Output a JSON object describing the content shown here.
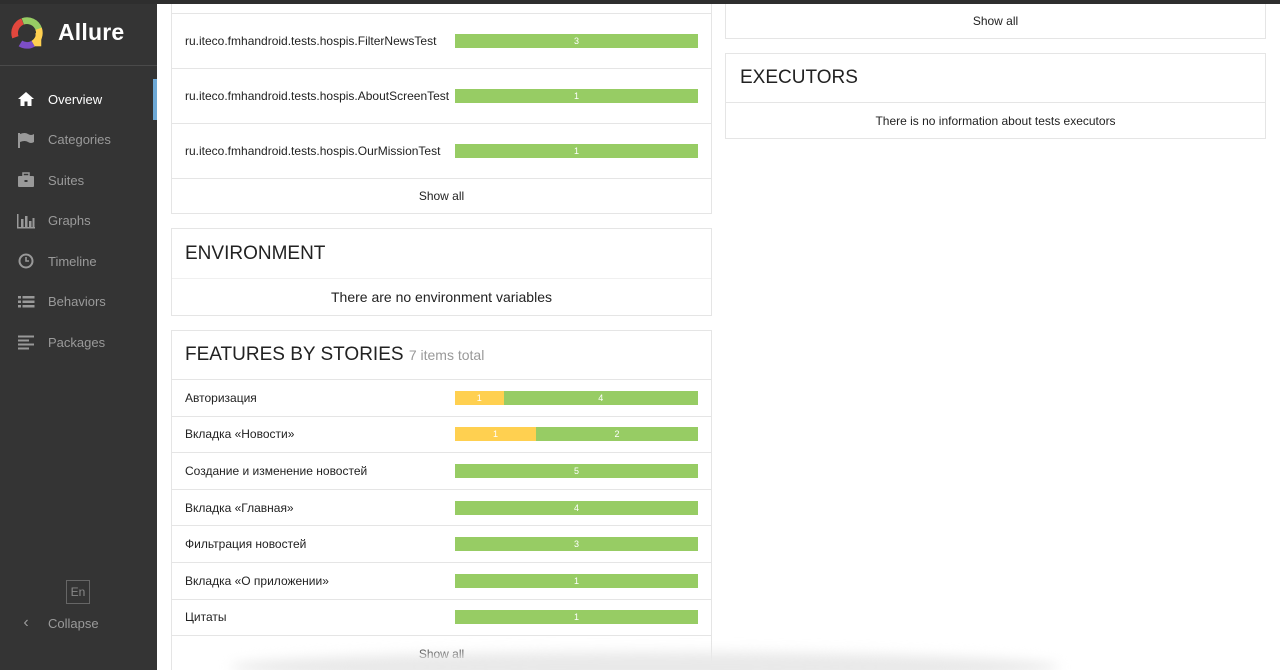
{
  "app": {
    "name": "Allure"
  },
  "sidebar": {
    "items": [
      {
        "label": "Overview",
        "icon": "home-icon",
        "active": true
      },
      {
        "label": "Categories",
        "icon": "flag-icon",
        "active": false
      },
      {
        "label": "Suites",
        "icon": "briefcase-icon",
        "active": false
      },
      {
        "label": "Graphs",
        "icon": "bar-chart-icon",
        "active": false
      },
      {
        "label": "Timeline",
        "icon": "clock-icon",
        "active": false
      },
      {
        "label": "Behaviors",
        "icon": "list-icon",
        "active": false
      },
      {
        "label": "Packages",
        "icon": "align-left-icon",
        "active": false
      }
    ],
    "language": "En",
    "collapse_label": "Collapse"
  },
  "suites_panel": {
    "rows": [
      {
        "name": "ru.iteco.fmhandroid.tests.hospis.FilterNewsTest",
        "passed": 3
      },
      {
        "name": "ru.iteco.fmhandroid.tests.hospis.AboutScreenTest",
        "passed": 1
      },
      {
        "name": "ru.iteco.fmhandroid.tests.hospis.OurMissionTest",
        "passed": 1
      }
    ],
    "show_all": "Show all"
  },
  "environment": {
    "title": "ENVIRONMENT",
    "empty_text": "There are no environment variables"
  },
  "features": {
    "title": "FEATURES BY STORIES",
    "subtitle": "7 items total",
    "rows": [
      {
        "name": "Авторизация",
        "broken": 1,
        "passed": 4
      },
      {
        "name": "Вкладка «Новости»",
        "broken": 1,
        "passed": 2
      },
      {
        "name": "Создание и изменение новостей",
        "broken": 0,
        "passed": 5
      },
      {
        "name": "Вкладка «Главная»",
        "broken": 0,
        "passed": 4
      },
      {
        "name": "Фильтрация новостей",
        "broken": 0,
        "passed": 3
      },
      {
        "name": "Вкладка «О приложении»",
        "broken": 0,
        "passed": 1
      },
      {
        "name": "Цитаты",
        "broken": 0,
        "passed": 1
      }
    ],
    "show_all": "Show all"
  },
  "right_top": {
    "show_all": "Show all"
  },
  "executors": {
    "title": "EXECUTORS",
    "empty_text": "There is no information about tests executors"
  },
  "colors": {
    "passed": "#97cc64",
    "broken": "#ffd050",
    "sidebar": "#343434",
    "active_marker": "#6ea9d6"
  }
}
